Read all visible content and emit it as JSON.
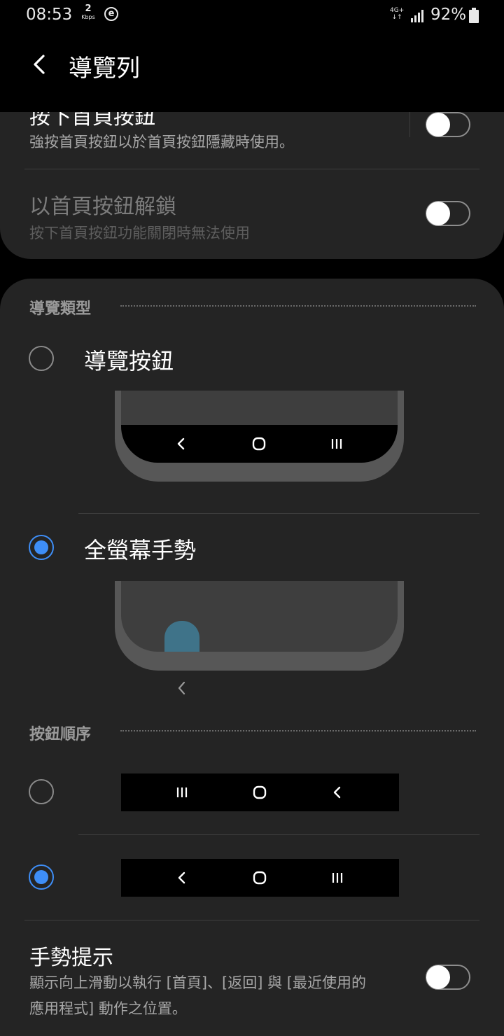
{
  "status_bar": {
    "time": "08:53",
    "data_rate": "2",
    "data_unit": "Kbps",
    "e_icon": "e",
    "network": "4G+",
    "battery": "92%"
  },
  "header": {
    "title": "導覽列"
  },
  "settings": {
    "press_home": {
      "title": "按下首頁按鈕",
      "subtitle": "強按首頁按鈕以於首頁按鈕隱藏時使用。",
      "enabled": false
    },
    "unlock_home": {
      "title": "以首頁按鈕解鎖",
      "subtitle": "按下首頁按鈕功能關閉時無法使用",
      "enabled": false
    }
  },
  "nav_type": {
    "section_label": "導覽類型",
    "options": [
      {
        "label": "導覽按鈕",
        "selected": false
      },
      {
        "label": "全螢幕手勢",
        "selected": true
      }
    ]
  },
  "button_order": {
    "section_label": "按鈕順序",
    "options": [
      {
        "order": [
          "recents-icon",
          "home-icon",
          "back-icon"
        ],
        "selected": false
      },
      {
        "order": [
          "back-icon",
          "home-icon",
          "recents-icon"
        ],
        "selected": true
      }
    ]
  },
  "gesture_hint": {
    "title": "手勢提示",
    "subtitle_line1": "顯示向上滑動以執行 [首頁]、[返回] 與 [最近使用的",
    "subtitle_line2": "應用程式] 動作之位置。",
    "enabled": false
  },
  "colors": {
    "accent": "#3e8ef7",
    "card": "#242424",
    "background": "#000000"
  }
}
